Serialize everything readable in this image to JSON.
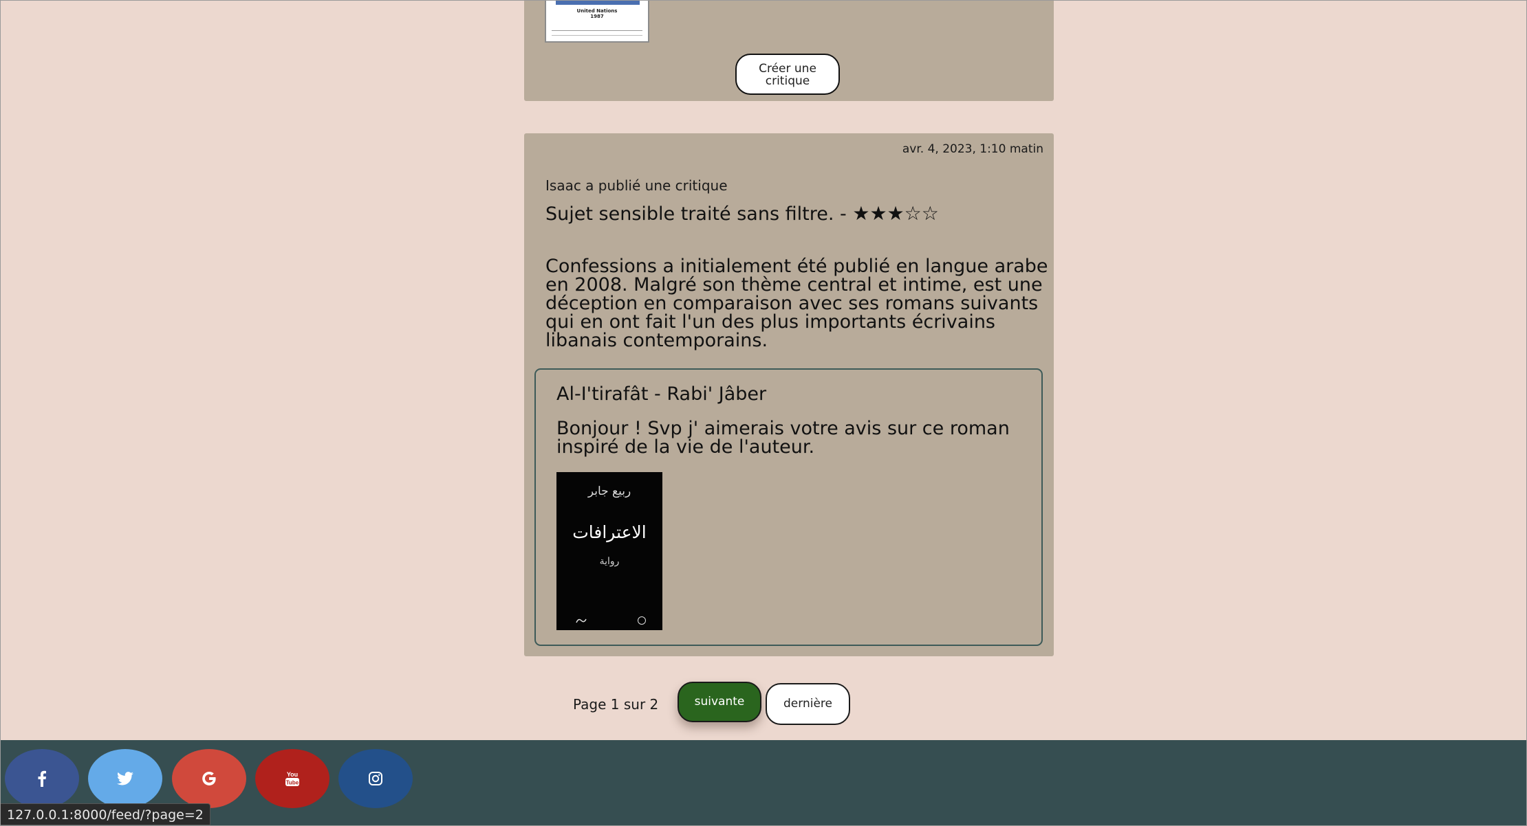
{
  "top_ticket": {
    "cover": {
      "org_line1": "United Nations",
      "org_line2": "1987"
    },
    "create_review_label": "Créer une critique"
  },
  "review": {
    "timestamp": "avr. 4, 2023, 1:10 matin",
    "author_line": "Isaac a publié une critique",
    "headline": "Sujet sensible traité sans filtre. -",
    "rating": 3,
    "rating_max": 5,
    "stars_text": "★★★☆☆",
    "body": "Confessions a initialement été publié en langue arabe en 2008. Malgré son thème central et intime, est une déception en comparaison avec ses romans suivants qui en ont fait l'un des plus importants écrivains libanais contemporains.",
    "ticket": {
      "title": "Al-I'tirafât - Rabi' Jâber",
      "description": "Bonjour ! Svp j' aimerais votre avis sur ce roman inspiré de la vie de l'auteur.",
      "cover": {
        "author": "ربيع جابر",
        "title": "الاعترافات",
        "subtitle": "رواية",
        "logo_left": "Saqi"
      }
    }
  },
  "pagination": {
    "label": "Page 1 sur 2",
    "next_label": "suivante",
    "last_label": "dernière"
  },
  "footer": {
    "social": [
      {
        "icon": "facebook-icon",
        "color": "#3b5592"
      },
      {
        "icon": "twitter-icon",
        "color": "#64aae8"
      },
      {
        "icon": "google-icon",
        "color": "#d0493c"
      },
      {
        "icon": "youtube-icon",
        "color": "#b0211c"
      },
      {
        "icon": "instagram-icon",
        "color": "#23508a"
      }
    ]
  },
  "status_bar": {
    "url": "127.0.0.1:8000/feed/?page=2"
  }
}
